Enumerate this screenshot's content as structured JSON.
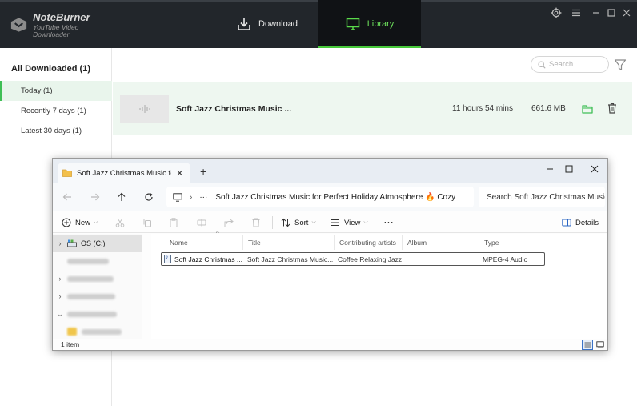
{
  "app": {
    "logo_name": "NoteBurner",
    "logo_sub": "YouTube Video Downloader",
    "tabs": [
      {
        "label": "Download",
        "active": false
      },
      {
        "label": "Library",
        "active": true
      }
    ],
    "accent_color": "#47c93a",
    "window_controls": [
      "settings-icon",
      "menu-icon",
      "minimize-icon",
      "maximize-icon",
      "close-icon"
    ]
  },
  "sidebar": {
    "heading": "All Downloaded (1)",
    "items": [
      {
        "label": "Today (1)",
        "active": true
      },
      {
        "label": "Recently 7 days (1)",
        "active": false
      },
      {
        "label": "Latest 30 days (1)",
        "active": false
      }
    ]
  },
  "library": {
    "search_placeholder": "Search",
    "track": {
      "title": "Soft Jazz Christmas Music ...",
      "duration": "11 hours 54 mins",
      "size": "661.6 MB"
    }
  },
  "explorer": {
    "tab_title": "Soft Jazz Christmas Music for I",
    "tab_close": "✕",
    "new_tab": "+",
    "address_ellipsis": "···",
    "address_path": "Soft Jazz Christmas Music for Perfect Holiday Atmosphere 🔥 Cozy",
    "search_placeholder": "Search Soft Jazz Christmas Music",
    "toolbar": {
      "new_label": "New",
      "sort_label": "Sort",
      "view_label": "View",
      "more_label": "···",
      "details_label": "Details"
    },
    "tree": [
      {
        "label": "OS (C:)",
        "blurred": false,
        "selected": true,
        "chevron": "›"
      },
      {
        "label": "",
        "blurred": true,
        "selected": false,
        "chevron": ""
      },
      {
        "label": "",
        "blurred": true,
        "selected": false,
        "chevron": "›"
      },
      {
        "label": "",
        "blurred": true,
        "selected": false,
        "chevron": "›"
      },
      {
        "label": "",
        "blurred": true,
        "selected": false,
        "chevron": "⌄"
      },
      {
        "label": "",
        "blurred": true,
        "selected": false,
        "chevron": ""
      },
      {
        "label": "",
        "blurred": true,
        "selected": false,
        "chevron": "›"
      }
    ],
    "columns": [
      "Name",
      "Title",
      "Contributing artists",
      "Album",
      "Type"
    ],
    "rows": [
      {
        "name": "Soft Jazz Christmas ...",
        "title": "Soft Jazz Christmas Music...",
        "artist": "Coffee Relaxing Jazz",
        "album": "",
        "type": "MPEG-4 Audio"
      }
    ],
    "status_count": "1 item"
  }
}
